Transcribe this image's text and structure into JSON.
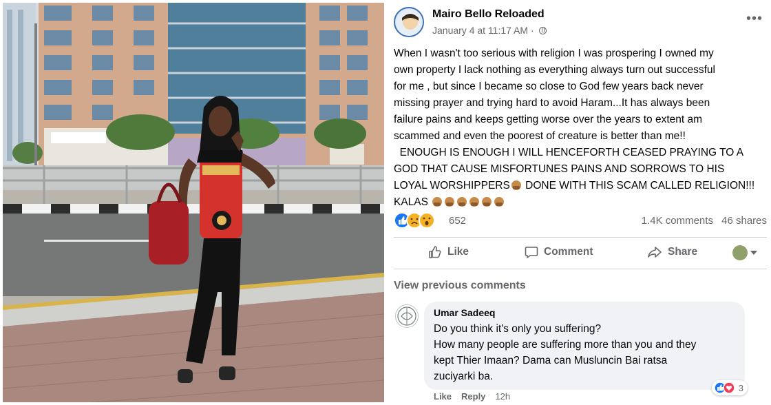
{
  "post": {
    "author": "Mairo Bello Reloaded",
    "timestamp": "January 4 at 11:17 AM",
    "dot_separator": "·",
    "more_label": "•••",
    "text_lines": [
      "When I wasn't too serious with religion I was prospering I owned my",
      "own property I lack nothing as everything always turn out successful",
      "for me , but since I became so close to God few years back never",
      "missing prayer and trying hard to avoid Haram...It has always been",
      "failure pains and keeps getting worse over the years to extent am",
      "scammed and even the poorest of creature is better than me!!",
      "  ENOUGH IS ENOUGH I WILL HENCEFORTH CEASED PRAYING TO A",
      "GOD THAT CAUSE MISFORTUNES PAINS AND SORROWS TO HIS",
      "LOYAL WORSHIPPERS",
      " DONE WITH THIS SCAM CALLED RELIGION!!!",
      "KALAS"
    ],
    "reaction_count": "652",
    "comments_count": "1.4K comments",
    "shares_count": "46 shares"
  },
  "actions": {
    "like": "Like",
    "comment": "Comment",
    "share": "Share"
  },
  "comments": {
    "view_previous": "View previous comments",
    "items": [
      {
        "name": "Umar Sadeeq",
        "lines": [
          "Do you think it's only you suffering?",
          "How many people are suffering more than you and they",
          "kept Thier Imaan? Dama can Musluncin Bai ratsa",
          "zuciyarki ba."
        ],
        "reaction_count": "3",
        "like": "Like",
        "reply": "Reply",
        "age": "12h"
      }
    ]
  },
  "colors": {
    "facebook_blue": "#1877f2",
    "secondary_text": "#65676b",
    "bubble_bg": "#f0f2f5",
    "divider": "#ced0d4"
  },
  "icons": {
    "like_reaction": "like-reaction-icon",
    "sad_reaction": "sad-reaction-icon",
    "wow_reaction": "wow-reaction-icon",
    "love_reaction": "love-reaction-icon",
    "globe": "globe-icon",
    "thumbs_up": "thumbs-up-icon",
    "comment": "comment-icon",
    "share": "share-icon"
  }
}
